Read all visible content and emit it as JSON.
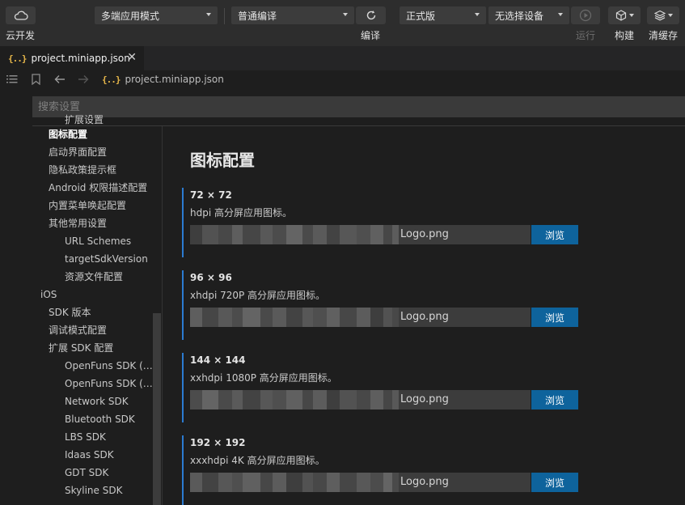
{
  "toolbar": {
    "cloud_label": "云开发",
    "mode_select": "多端应用模式",
    "compile_select": "普通编译",
    "compile_label": "编译",
    "version_select": "正式版",
    "device_select": "无选择设备",
    "run_label": "运行",
    "build_label": "构建",
    "clear_cache_label": "清缓存"
  },
  "tab": {
    "title": "project.miniapp.json",
    "icon_text": "{..}"
  },
  "breadcrumb": {
    "icon_text": "{..}",
    "file": "project.miniapp.json"
  },
  "search": {
    "placeholder": "搜索设置"
  },
  "tree": {
    "items": [
      {
        "label": "扩展设置",
        "level": 2
      },
      {
        "label": "图标配置",
        "level": 1,
        "active": true
      },
      {
        "label": "启动界面配置",
        "level": 1
      },
      {
        "label": "隐私政策提示框",
        "level": 1
      },
      {
        "label": "Android 权限描述配置",
        "level": 1
      },
      {
        "label": "内置菜单唤起配置",
        "level": 1
      },
      {
        "label": "其他常用设置",
        "level": 1
      },
      {
        "label": "URL Schemes",
        "level": 2
      },
      {
        "label": "targetSdkVersion",
        "level": 2
      },
      {
        "label": "资源文件配置",
        "level": 2
      },
      {
        "label": "iOS",
        "level": 0
      },
      {
        "label": "SDK 版本",
        "level": 1
      },
      {
        "label": "调试模式配置",
        "level": 1
      },
      {
        "label": "扩展 SDK 配置",
        "level": 1
      },
      {
        "label": "OpenFuns SDK (…",
        "level": 2
      },
      {
        "label": "OpenFuns SDK (…",
        "level": 2
      },
      {
        "label": "Network SDK",
        "level": 2
      },
      {
        "label": "Bluetooth SDK",
        "level": 2
      },
      {
        "label": "LBS SDK",
        "level": 2
      },
      {
        "label": "Idaas SDK",
        "level": 2
      },
      {
        "label": "GDT SDK",
        "level": 2
      },
      {
        "label": "Skyline SDK",
        "level": 2
      }
    ]
  },
  "main": {
    "title": "图标配置",
    "sections": [
      {
        "size": "72 × 72",
        "desc": "hdpi 高分屏应用图标。",
        "file": "Logo.png",
        "browse": "浏览"
      },
      {
        "size": "96 × 96",
        "desc": "xhdpi 720P 高分屏应用图标。",
        "file": "Logo.png",
        "browse": "浏览"
      },
      {
        "size": "144 × 144",
        "desc": "xxhdpi 1080P 高分屏应用图标。",
        "file": "Logo.png",
        "browse": "浏览"
      },
      {
        "size": "192 × 192",
        "desc": "xxxhdpi 4K 高分屏应用图标。",
        "file": "Logo.png",
        "browse": "浏览"
      }
    ]
  },
  "colors": {
    "accent": "#2b7bd1",
    "button": "#0e639c",
    "json_icon": "#e8b84a"
  }
}
